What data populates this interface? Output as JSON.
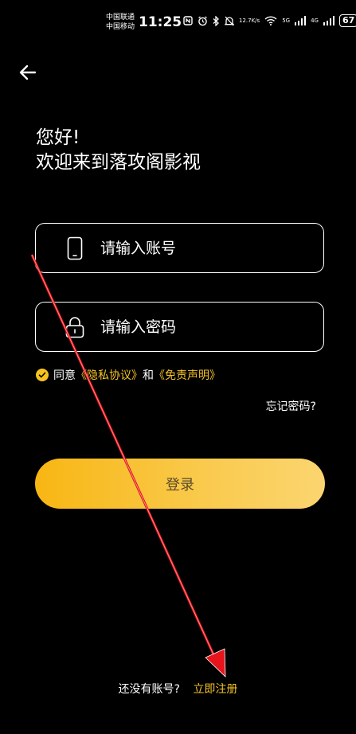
{
  "status_bar": {
    "carrier_1": "中国联通",
    "carrier_2": "中国移动",
    "time": "11:25",
    "net_speed_value": "12.7",
    "net_speed_unit": "K/s",
    "net_5g": "5G",
    "net_4g": "4G",
    "battery": "67",
    "icons": [
      "nfc-icon",
      "alarm-icon",
      "bluetooth-icon",
      "mute-icon",
      "wifi-icon",
      "signal-icon"
    ]
  },
  "header": {
    "back_icon": "arrow-left-icon"
  },
  "greeting": {
    "line1": "您好!",
    "line2": "欢迎来到落攻阁影视"
  },
  "form": {
    "account_placeholder": "请输入账号",
    "account_icon": "phone-icon",
    "password_placeholder": "请输入密码",
    "password_icon": "lock-icon"
  },
  "agreement": {
    "prefix": "同意",
    "privacy_link": "《隐私协议》",
    "conjunction": "和",
    "disclaimer_link": "《免责声明》"
  },
  "forgot_password": "忘记密码?",
  "login_button": "登录",
  "register": {
    "prompt": "还没有账号?",
    "link": "立即注册"
  },
  "colors": {
    "background": "#000000",
    "accent": "#f5c227",
    "button_gradient_start": "#f8b613",
    "button_gradient_end": "#fbd570",
    "arrow": "#e8141b"
  }
}
